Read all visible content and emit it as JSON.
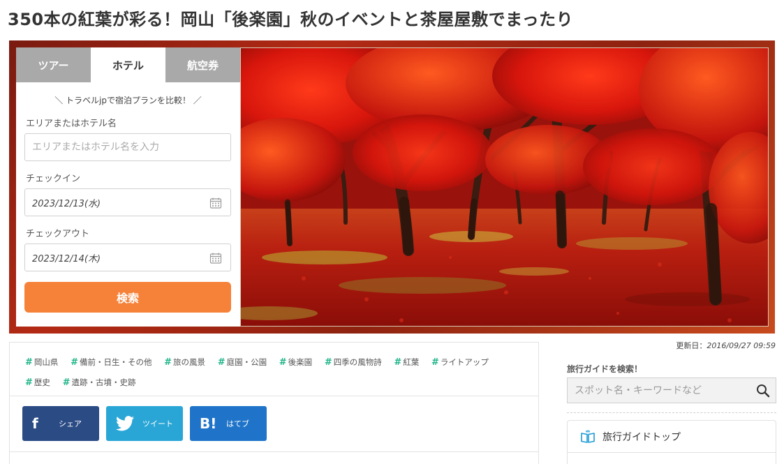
{
  "article": {
    "title": "350本の紅葉が彩る！岡山「後楽園」秋のイベントと茶屋屋敷でまったり",
    "updated_label": "更新日：",
    "updated_date": "2016/09/27 09:59"
  },
  "booking": {
    "tabs": [
      {
        "label": "ツアー",
        "active": false
      },
      {
        "label": "ホテル",
        "active": true
      },
      {
        "label": "航空券",
        "active": false
      }
    ],
    "tagline": "＼ トラベルjpで宿泊プランを比較！ ／",
    "area_label": "エリアまたはホテル名",
    "area_placeholder": "エリアまたはホテル名を入力",
    "checkin_label": "チェックイン",
    "checkin_value": "2023/12/13(水)",
    "checkout_label": "チェックアウト",
    "checkout_value": "2023/12/14(木)",
    "search_label": "検索"
  },
  "tags": [
    "岡山県",
    "備前・日生・その他",
    "旅の風景",
    "庭園・公園",
    "後楽園",
    "四季の風物詩",
    "紅葉",
    "ライトアップ",
    "歴史",
    "遺跡・古墳・史跡"
  ],
  "share": {
    "facebook": {
      "icon": "f",
      "label": "シェア"
    },
    "twitter": {
      "label": "ツイート"
    },
    "hatena": {
      "icon": "B!",
      "label": "はてブ"
    }
  },
  "sidebar": {
    "search_title": "旅行ガイドを検索！",
    "search_placeholder": "スポット名・キーワードなど",
    "menu_top": "旅行ガイドトップ"
  },
  "colors": {
    "accent_orange": "#f6823a",
    "tag_green": "#1fb589",
    "facebook": "#2b4b84",
    "twitter": "#2aa6d6",
    "hatena": "#1f74c9"
  },
  "icons": [
    "calendar-icon",
    "magnifier-icon",
    "book-icon",
    "facebook-icon",
    "twitter-icon",
    "hatena-icon"
  ]
}
